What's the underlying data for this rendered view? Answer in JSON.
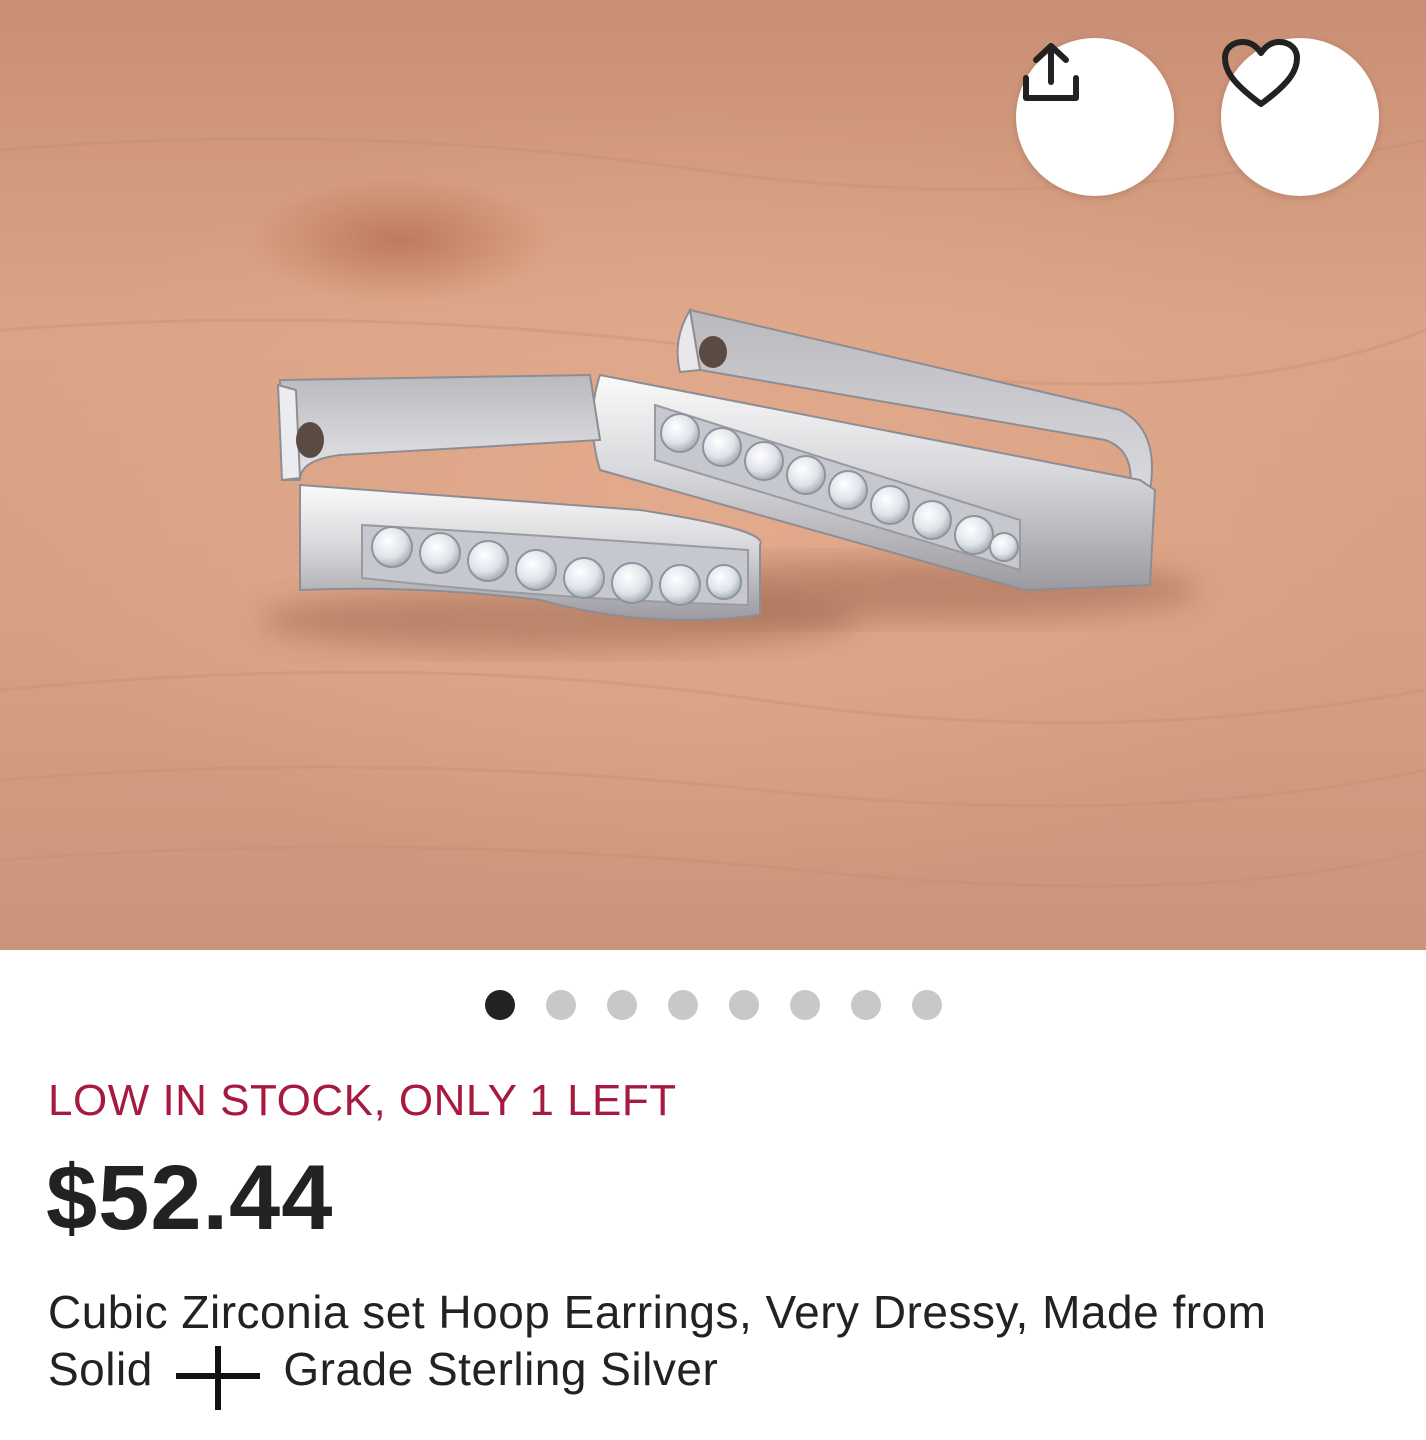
{
  "product": {
    "stock_notice": "LOW IN STOCK, ONLY 1 LEFT",
    "price": "$52.44",
    "title_part1": "Cubic Zirconia set Hoop Earrings, Very Dressy, Made from Solid",
    "title_part2": "Grade Sterling Silver"
  },
  "image_pager": {
    "count": 8,
    "active_index": 0
  },
  "actions": {
    "share_icon": "share-icon",
    "favorite_icon": "heart-icon"
  },
  "colors": {
    "stock_text": "#a61a3f",
    "price_text": "#222222",
    "dot_active": "#222222",
    "dot_inactive": "#c8c8c8"
  }
}
